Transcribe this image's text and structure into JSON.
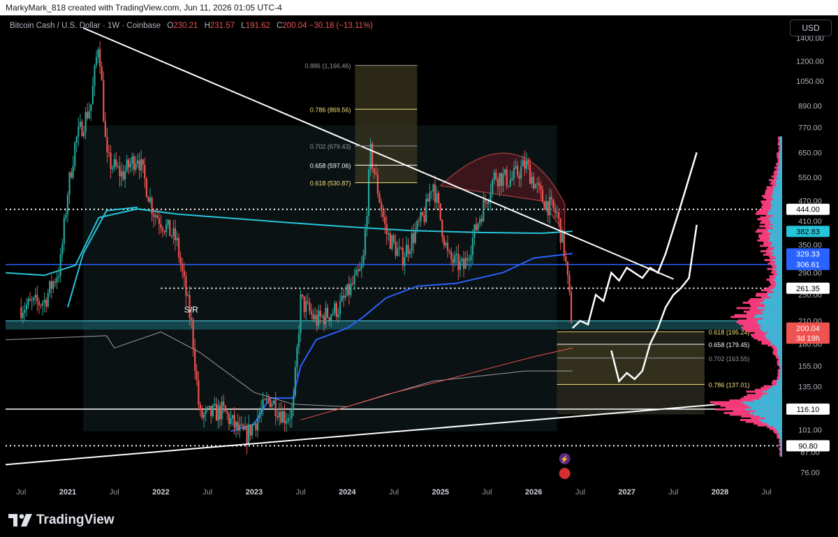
{
  "topbar": {
    "text": "MarkyMark_818 created with TradingView.com, Jun 11, 2026 01:05 UTC-4"
  },
  "header": {
    "symbol": "Bitcoin Cash / U.S. Dollar · 1W · Coinbase",
    "o_label": "O",
    "o": "230.21",
    "h_label": "H",
    "h": "231.57",
    "l_label": "L",
    "l": "191.62",
    "c_label": "C",
    "c": "200.04",
    "change": "−30.18 (−13.11%)"
  },
  "currency_button": "USD",
  "logo_text": "TradingView",
  "colors": {
    "background": "#000000",
    "candle_up": "#26a69a",
    "candle_down": "#ef5350",
    "cyan_line": "#26c6da",
    "blue_line": "#2962ff",
    "fib": "#f5e07a",
    "profile_pink": "#ff3d7f",
    "profile_cyan": "#29c3e0"
  },
  "chart_data": {
    "type": "candlestick",
    "symbol": "Bitcoin Cash / U.S. Dollar",
    "timeframe": "1W",
    "exchange": "Coinbase",
    "y_scale": "log",
    "ylim": [
      68,
      1500
    ],
    "x_range": [
      "2020-05",
      "2028-09"
    ],
    "x_ticks": [
      {
        "label": "Jul",
        "date": "2020-07"
      },
      {
        "label": "2021",
        "date": "2021-01"
      },
      {
        "label": "Jul",
        "date": "2021-07"
      },
      {
        "label": "2022",
        "date": "2022-01"
      },
      {
        "label": "Jul",
        "date": "2022-07"
      },
      {
        "label": "2023",
        "date": "2023-01"
      },
      {
        "label": "Jul",
        "date": "2023-07"
      },
      {
        "label": "2024",
        "date": "2024-01"
      },
      {
        "label": "Jul",
        "date": "2024-07"
      },
      {
        "label": "2025",
        "date": "2025-01"
      },
      {
        "label": "Jul",
        "date": "2025-07"
      },
      {
        "label": "2026",
        "date": "2026-01"
      },
      {
        "label": "Jul",
        "date": "2026-07"
      },
      {
        "label": "2027",
        "date": "2027-01"
      },
      {
        "label": "Jul",
        "date": "2027-07"
      },
      {
        "label": "2028",
        "date": "2028-01"
      },
      {
        "label": "Jul",
        "date": "2028-07"
      }
    ],
    "y_ticks": [
      1400,
      1200,
      1050,
      890,
      770,
      650,
      550,
      470,
      410,
      350,
      290,
      250,
      210,
      180,
      155,
      135,
      116,
      101,
      87,
      76
    ],
    "price_path": [
      [
        "2020-07",
        230
      ],
      [
        "2020-10",
        240
      ],
      [
        "2020-12",
        300
      ],
      [
        "2021-01",
        500
      ],
      [
        "2021-02",
        700
      ],
      [
        "2021-04",
        900
      ],
      [
        "2021-05",
        1400
      ],
      [
        "2021-06",
        620
      ],
      [
        "2021-08",
        560
      ],
      [
        "2021-10",
        640
      ],
      [
        "2021-12",
        440
      ],
      [
        "2022-03",
        360
      ],
      [
        "2022-05",
        200
      ],
      [
        "2022-06",
        110
      ],
      [
        "2022-09",
        115
      ],
      [
        "2022-11",
        100
      ],
      [
        "2022-12",
        97
      ],
      [
        "2023-03",
        125
      ],
      [
        "2023-05",
        110
      ],
      [
        "2023-06",
        115
      ],
      [
        "2023-07",
        240
      ],
      [
        "2023-09",
        210
      ],
      [
        "2023-12",
        230
      ],
      [
        "2024-03",
        300
      ],
      [
        "2024-04",
        650
      ],
      [
        "2024-06",
        380
      ],
      [
        "2024-08",
        320
      ],
      [
        "2024-11",
        430
      ],
      [
        "2024-12",
        540
      ],
      [
        "2025-02",
        320
      ],
      [
        "2025-04",
        300
      ],
      [
        "2025-06",
        420
      ],
      [
        "2025-08",
        560
      ],
      [
        "2025-10",
        540
      ],
      [
        "2025-12",
        600
      ],
      [
        "2026-02",
        480
      ],
      [
        "2026-04",
        430
      ],
      [
        "2026-05",
        330
      ],
      [
        "2026-06",
        200
      ]
    ],
    "horizontal_levels": [
      {
        "price": 444.0,
        "style": "dotted",
        "color": "#ffffff"
      },
      {
        "price": 306.61,
        "style": "solid",
        "color": "#2962ff"
      },
      {
        "price": 261.35,
        "style": "dotted",
        "color": "#ffffff"
      },
      {
        "price": 116.1,
        "style": "solid",
        "color": "#ffffff"
      },
      {
        "price": 90.8,
        "style": "dotted",
        "color": "#ffffff"
      }
    ],
    "price_labels": [
      {
        "text": "444.00",
        "price": 444.0,
        "bg": "#ffffff",
        "fg": "#000000"
      },
      {
        "text": "382.83",
        "price": 382.83,
        "bg": "#26c6da",
        "fg": "#000000"
      },
      {
        "text": "329.33",
        "price": 329.33,
        "bg": "#2962ff",
        "fg": "#ffffff"
      },
      {
        "text": "306.61",
        "price": 306.61,
        "bg": "#2962ff",
        "fg": "#ffffff"
      },
      {
        "text": "261.35",
        "price": 261.35,
        "bg": "#ffffff",
        "fg": "#000000"
      },
      {
        "text": "200.04",
        "price": 200.04,
        "bg": "#ef5350",
        "fg": "#ffffff"
      },
      {
        "text": "3d 19h",
        "price": 187,
        "bg": "#ef5350",
        "fg": "#ffffff"
      },
      {
        "text": "116.10",
        "price": 116.1,
        "bg": "#ffffff",
        "fg": "#000000"
      },
      {
        "text": "90.80",
        "price": 90.8,
        "bg": "#ffffff",
        "fg": "#000000"
      }
    ],
    "fib_upper": [
      {
        "text": "0.886 (1,166.46)",
        "price": 1166.46,
        "color": "#9598a1"
      },
      {
        "text": "0.786 (869.56)",
        "price": 869.56,
        "color": "#f5e07a"
      },
      {
        "text": "0.702 (679.43)",
        "price": 679.43,
        "color": "#9598a1"
      },
      {
        "text": "0.658 (597.06)",
        "price": 597.06,
        "color": "#ffffff"
      },
      {
        "text": "0.618 (530.87)",
        "price": 530.87,
        "color": "#f5e07a"
      }
    ],
    "fib_lower": [
      {
        "text": "0.618 (195.24)",
        "price": 195.24,
        "color": "#f5e07a"
      },
      {
        "text": "0.658 (179.45)",
        "price": 179.45,
        "color": "#ffffff"
      },
      {
        "text": "0.702 (163.55)",
        "price": 163.55,
        "color": "#9598a1"
      },
      {
        "text": "0.786 (137.01)",
        "price": 137.01,
        "color": "#f5e07a"
      }
    ],
    "annotations": [
      {
        "text": "S/R",
        "date": "2022-04",
        "price": 222
      }
    ],
    "sr_zone": [
      198,
      210
    ],
    "projection_paths": [
      [
        [
          "2026-06",
          200
        ],
        [
          "2026-07",
          210
        ],
        [
          "2026-08",
          205
        ],
        [
          "2026-09",
          250
        ],
        [
          "2026-10",
          240
        ],
        [
          "2026-11",
          290
        ],
        [
          "2026-12",
          275
        ],
        [
          "2027-01",
          300
        ],
        [
          "2027-03",
          280
        ],
        [
          "2027-04",
          300
        ],
        [
          "2027-05",
          290
        ],
        [
          "2027-06",
          330
        ],
        [
          "2027-08",
          460
        ],
        [
          "2027-10",
          650
        ]
      ],
      [
        [
          "2026-11",
          172
        ],
        [
          "2026-12",
          140
        ],
        [
          "2027-01",
          148
        ],
        [
          "2027-02",
          142
        ],
        [
          "2027-03",
          150
        ],
        [
          "2027-04",
          180
        ],
        [
          "2027-05",
          200
        ],
        [
          "2027-06",
          230
        ],
        [
          "2027-07",
          250
        ],
        [
          "2027-08",
          262
        ],
        [
          "2027-09",
          280
        ],
        [
          "2027-10",
          400
        ]
      ]
    ]
  }
}
